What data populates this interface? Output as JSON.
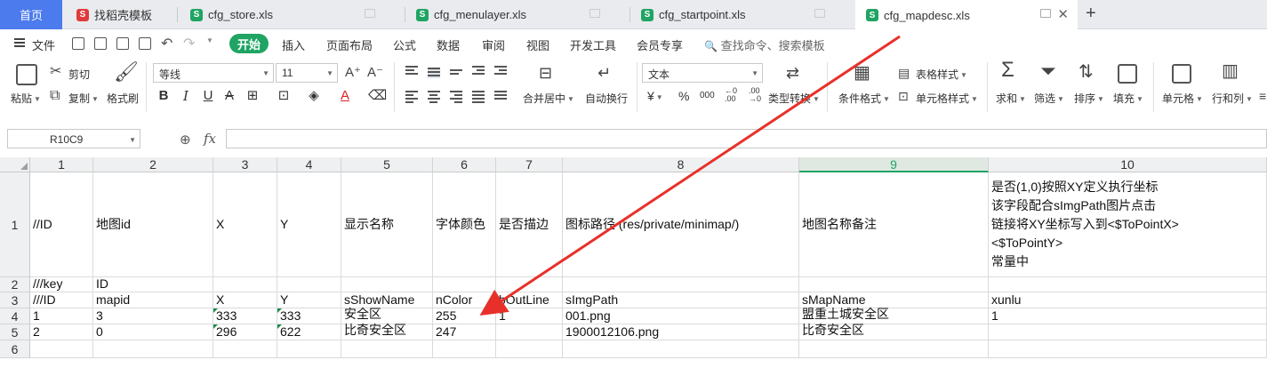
{
  "tabs": {
    "home": "首页",
    "items": [
      {
        "label": "找稻壳模板",
        "icon": "docer-icon"
      },
      {
        "label": "cfg_store.xls",
        "icon": "sheet-icon"
      },
      {
        "label": "cfg_menulayer.xls",
        "icon": "sheet-icon"
      },
      {
        "label": "cfg_startpoint.xls",
        "icon": "sheet-icon"
      },
      {
        "label": "cfg_mapdesc.xls",
        "icon": "sheet-icon",
        "active": true
      }
    ],
    "new_tab": "+"
  },
  "menu": {
    "file": "文件",
    "items": [
      "开始",
      "插入",
      "页面布局",
      "公式",
      "数据",
      "审阅",
      "视图",
      "开发工具",
      "会员专享"
    ],
    "search": "查找命令、搜索模板"
  },
  "ribbon": {
    "paste": "粘贴",
    "cut": "剪切",
    "copy": "复制",
    "format_painter": "格式刷",
    "font_name": "等线",
    "font_size": "11",
    "merge_center": "合并居中",
    "auto_wrap": "自动换行",
    "number_format": "文本",
    "currency": "¥",
    "percent": "%",
    "thousands": "000",
    "type_convert": "类型转换",
    "cond_format": "条件格式",
    "table_style": "表格样式",
    "cell_style": "单元格样式",
    "sum": "求和",
    "filter": "筛选",
    "sort": "排序",
    "fill": "填充",
    "cell": "单元格",
    "row_col": "行和列"
  },
  "formula_bar": {
    "name_box": "R10C9",
    "fx": "fx",
    "value": ""
  },
  "sheet": {
    "columns": [
      "1",
      "2",
      "3",
      "4",
      "5",
      "6",
      "7",
      "8",
      "9",
      "10"
    ],
    "selected_column": "9",
    "row_numbers": [
      "1",
      "2",
      "3",
      "4",
      "5",
      "6"
    ],
    "rows": [
      [
        "//ID",
        "地图id",
        "X",
        "Y",
        "显示名称",
        "字体颜色",
        "是否描边",
        "图标路径 (res/private/minimap/)",
        "地图名称备注",
        "是否(1,0)按照XY定义执行坐标 该字段配合sImgPath图片点击 链接将XY坐标写入到<$ToPointX> <$ToPointY> 常量中"
      ],
      [
        "///key",
        "ID",
        "",
        "",
        "",
        "",
        "",
        "",
        "",
        ""
      ],
      [
        "///ID",
        "mapid",
        "X",
        "Y",
        "sShowName",
        "nColor",
        "bOutLine",
        "sImgPath",
        "sMapName",
        "xunlu"
      ],
      [
        "1",
        "3",
        "333",
        "333",
        "安全区",
        "255",
        "1",
        "001.png",
        "盟重土城安全区",
        "1"
      ],
      [
        "2",
        "0",
        "296",
        "622",
        "比奇安全区",
        "247",
        "",
        "1900012106.png",
        "比奇安全区",
        ""
      ],
      [
        "",
        "",
        "",
        "",
        "",
        "",
        "",
        "",
        "",
        ""
      ]
    ]
  },
  "colors": {
    "accent": "#1fa463",
    "arrow": "#e8302a",
    "home_tab": "#4b7bec"
  }
}
